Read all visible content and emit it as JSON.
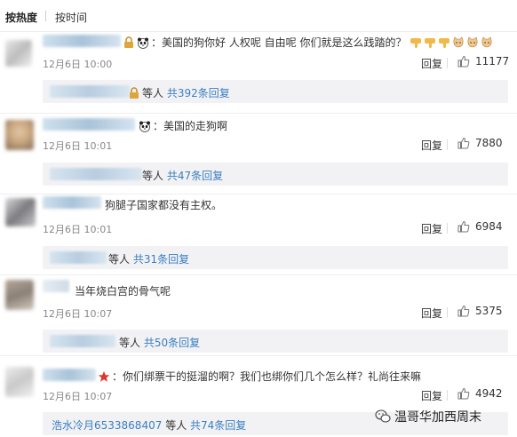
{
  "sort": {
    "hot": "按热度",
    "time": "按时间"
  },
  "comments": [
    {
      "text": "：美国的狗你好 人权呢 自由呢 你们就是这么践踏的？",
      "time": "12月6日 10:00",
      "reply": "回复",
      "likes": "11177",
      "sub_user": "",
      "sub_text": "等人",
      "sub_more": "共392条回复"
    },
    {
      "text": "：美国的走狗啊",
      "time": "12月6日 10:01",
      "reply": "回复",
      "likes": "7880",
      "sub_user": "",
      "sub_text": "等人",
      "sub_more": "共47条回复"
    },
    {
      "text": "狗腿子国家都没有主权。",
      "time": "12月6日 10:01",
      "reply": "回复",
      "likes": "6984",
      "sub_user": "",
      "sub_text": "等人",
      "sub_more": "共31条回复"
    },
    {
      "text": "当年烧白宫的骨气呢",
      "time": "12月6日 10:07",
      "reply": "回复",
      "likes": "5375",
      "sub_user": "",
      "sub_text": "等人",
      "sub_more": "共50条回复"
    },
    {
      "text": "：你们绑票干的挺溜的啊？我们也绑你们几个怎么样？礼尚往来嘛",
      "time": "12月6日 10:07",
      "reply": "回复",
      "likes": "4942",
      "sub_user": "浩水冷月6533868407",
      "sub_text": "等人",
      "sub_more": "共74条回复"
    }
  ],
  "watermark": "温哥华加西周末",
  "icons": {
    "like": "thumbs-up-icon",
    "panda": "panda-emoji-icon",
    "thumbs_down": "thumbs-down-emoji-icon",
    "cat": "cat-emoji-icon",
    "star": "red-star-icon",
    "wechat": "wechat-icon"
  }
}
